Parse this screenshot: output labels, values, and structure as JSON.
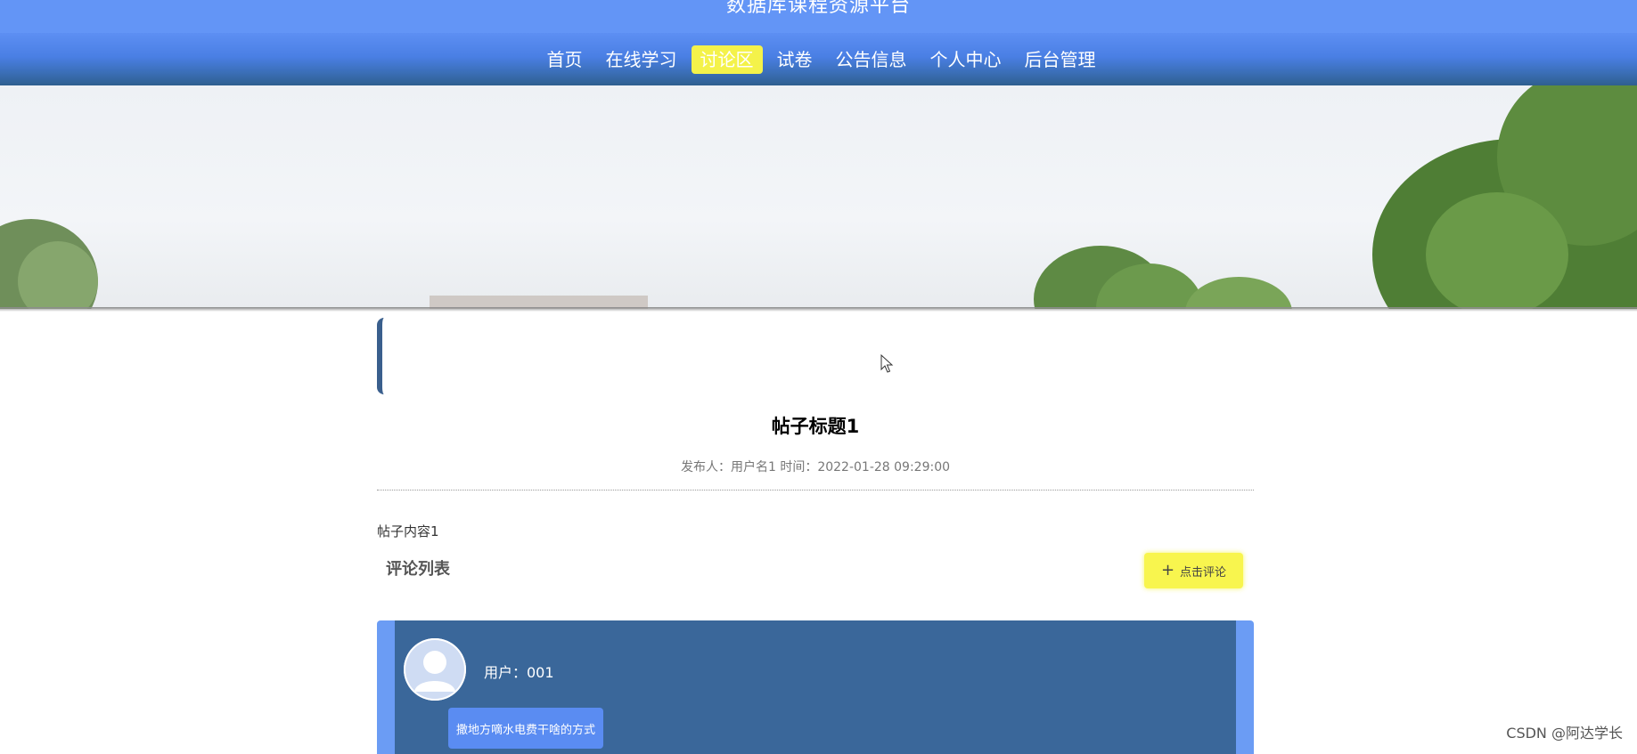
{
  "header": {
    "site_title": "数据库课程资源平台"
  },
  "nav": {
    "items": [
      {
        "label": "首页"
      },
      {
        "label": "在线学习"
      },
      {
        "label": "讨论区"
      },
      {
        "label": "试卷"
      },
      {
        "label": "公告信息"
      },
      {
        "label": "个人中心"
      },
      {
        "label": "后台管理"
      }
    ],
    "active": "讨论区"
  },
  "post": {
    "title": "帖子标题1",
    "meta": "发布人：用户名1 时间：2022-01-28 09:29:00",
    "body": "帖子内容1"
  },
  "comments": {
    "heading": "评论列表",
    "add_button_label": "点击评论",
    "items": [
      {
        "user": "用户：001",
        "text": "撒地方嘀水电费干啥的方式"
      }
    ]
  },
  "watermark": "CSDN @阿达学长",
  "colors": {
    "header_bg": "#6395f6",
    "active_nav": "#f4f24a",
    "card_bg": "#3a679a",
    "card_border": "#6b9cf4",
    "button_bg": "#f8f54e"
  }
}
